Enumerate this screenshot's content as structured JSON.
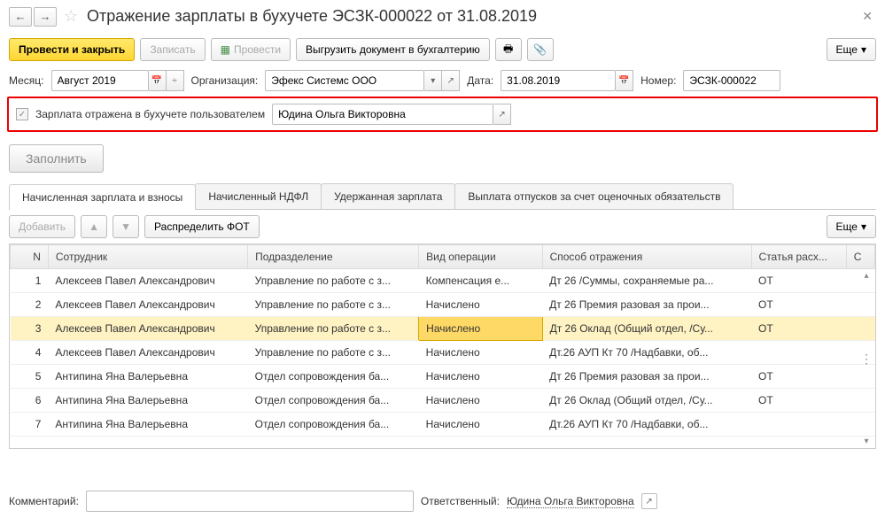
{
  "header": {
    "title": "Отражение зарплаты в бухучете ЭСЗК-000022 от 31.08.2019"
  },
  "toolbar": {
    "post_close": "Провести и закрыть",
    "save": "Записать",
    "post": "Провести",
    "export": "Выгрузить документ в бухгалтерию",
    "more": "Еще"
  },
  "form": {
    "month_label": "Месяц:",
    "month_value": "Август 2019",
    "org_label": "Организация:",
    "org_value": "Эфекс Системс ООО",
    "date_label": "Дата:",
    "date_value": "31.08.2019",
    "number_label": "Номер:",
    "number_value": "ЭСЗК-000022",
    "reflected_label": "Зарплата отражена в бухучете пользователем",
    "reflected_value": "Юдина Ольга Викторовна",
    "fill": "Заполнить"
  },
  "tabs": [
    "Начисленная зарплата и взносы",
    "Начисленный НДФЛ",
    "Удержанная зарплата",
    "Выплата отпусков за счет оценочных обязательств"
  ],
  "table_toolbar": {
    "add": "Добавить",
    "distribute": "Распределить ФОТ",
    "more": "Еще"
  },
  "columns": {
    "n": "N",
    "employee": "Сотрудник",
    "department": "Подразделение",
    "operation": "Вид операции",
    "reflection": "Способ отражения",
    "article": "Статья расх...",
    "c": "С"
  },
  "rows": [
    {
      "n": "1",
      "emp": "Алексеев Павел Александрович",
      "dep": "Управление по работе с з...",
      "op": "Компенсация е...",
      "ref": "Дт 26  /Суммы, сохраняемые ра...",
      "art": "ОТ"
    },
    {
      "n": "2",
      "emp": "Алексеев Павел Александрович",
      "dep": "Управление по работе с з...",
      "op": "Начислено",
      "ref": "Дт 26  Премия разовая  за прои...",
      "art": "ОТ"
    },
    {
      "n": "3",
      "emp": "Алексеев Павел Александрович",
      "dep": "Управление по работе с з...",
      "op": "Начислено",
      "ref": "Дт 26 Оклад (Общий отдел, /Су...",
      "art": "ОТ"
    },
    {
      "n": "4",
      "emp": "Алексеев Павел Александрович",
      "dep": "Управление по работе с з...",
      "op": "Начислено",
      "ref": "Дт.26  АУП  Кт 70  /Надбавки, об...",
      "art": ""
    },
    {
      "n": "5",
      "emp": "Антипина Яна Валерьевна",
      "dep": "Отдел сопровождения ба...",
      "op": "Начислено",
      "ref": "Дт 26  Премия разовая  за прои...",
      "art": "ОТ"
    },
    {
      "n": "6",
      "emp": "Антипина Яна Валерьевна",
      "dep": "Отдел сопровождения ба...",
      "op": "Начислено",
      "ref": "Дт 26 Оклад (Общий отдел, /Су...",
      "art": "ОТ"
    },
    {
      "n": "7",
      "emp": "Антипина Яна Валерьевна",
      "dep": "Отдел сопровождения ба...",
      "op": "Начислено",
      "ref": "Дт.26  АУП  Кт 70  /Надбавки, об...",
      "art": ""
    }
  ],
  "footer": {
    "comment_label": "Комментарий:",
    "responsible_label": "Ответственный:",
    "responsible_value": "Юдина Ольга Викторовна"
  }
}
